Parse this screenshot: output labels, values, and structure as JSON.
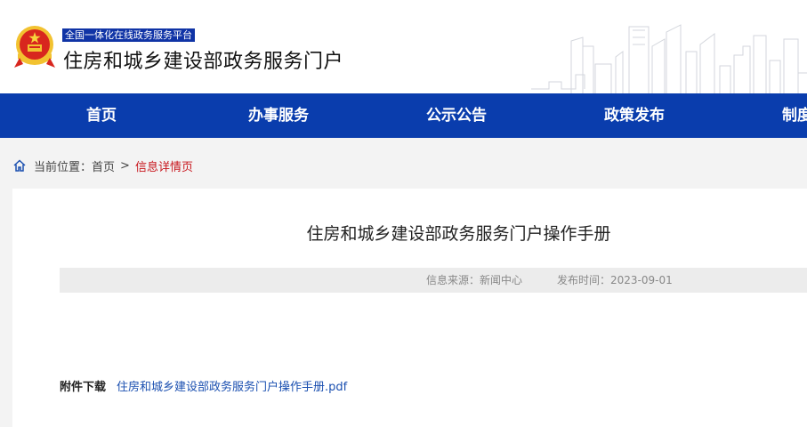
{
  "header": {
    "platform_tag": "全国一体化在线政务服务平台",
    "site_title": "住房和城乡建设部政务服务门户",
    "emblem_icon": "national-emblem-icon"
  },
  "nav": {
    "items": [
      {
        "label": "首页"
      },
      {
        "label": "办事服务"
      },
      {
        "label": "公示公告"
      },
      {
        "label": "政策发布"
      },
      {
        "label": "制度"
      }
    ],
    "background_color": "#0a3dad"
  },
  "breadcrumb": {
    "prefix": "当前位置：",
    "home": "首页",
    "separator": ">",
    "current": "信息详情页"
  },
  "article": {
    "title": "住房和城乡建设部政务服务门户操作手册",
    "source": "信息来源：新闻中心",
    "published": "发布时间：2023-09-01",
    "attachment_label": "附件下载",
    "attachment_file": "住房和城乡建设部政务服务门户操作手册.pdf"
  },
  "colors": {
    "accent": "#0a3dad",
    "current_crumb": "#c8161d",
    "link": "#1a4fb0"
  }
}
